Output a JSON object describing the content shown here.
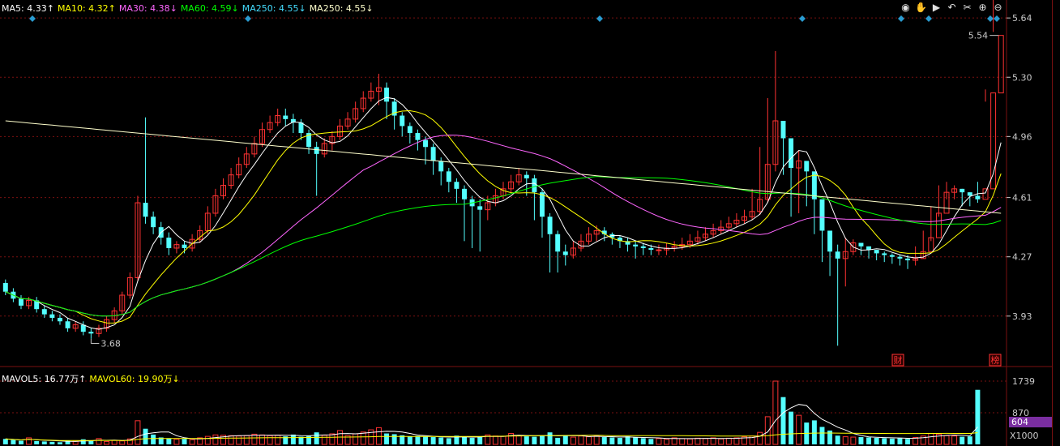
{
  "legend_price": [
    {
      "label": "MA5:",
      "value": "4.33",
      "arrow": "↑",
      "color": "#ffffff"
    },
    {
      "label": "MA10:",
      "value": "4.32",
      "arrow": "↑",
      "color": "#ffff00"
    },
    {
      "label": "MA30:",
      "value": "4.38",
      "arrow": "↓",
      "color": "#ff66ff"
    },
    {
      "label": "MA60:",
      "value": "4.59",
      "arrow": "↓",
      "color": "#00ff00"
    },
    {
      "label": "MA250:",
      "value": "4.55",
      "arrow": "↓",
      "color": "#44ddff"
    },
    {
      "label": "MA250:",
      "value": "4.55",
      "arrow": "↓",
      "color": "#ffffcc"
    }
  ],
  "legend_volume": [
    {
      "label": "MAVOL5:",
      "value": "16.77万",
      "arrow": "↑",
      "color": "#ffffff"
    },
    {
      "label": "MAVOL60:",
      "value": "19.90万",
      "arrow": "↓",
      "color": "#ffff00"
    }
  ],
  "toolbar": [
    {
      "name": "eye-icon",
      "glyph": "◉"
    },
    {
      "name": "hand-icon",
      "glyph": "✋"
    },
    {
      "name": "play-icon",
      "glyph": "▶"
    },
    {
      "name": "undo-icon",
      "glyph": "↶"
    },
    {
      "name": "scissors-icon",
      "glyph": "✂"
    },
    {
      "name": "zoom-in-icon",
      "glyph": "⊕"
    },
    {
      "name": "zoom-out-icon",
      "glyph": "⊖"
    }
  ],
  "volume_selected_label": "604",
  "volume_unit_label": "X1000",
  "colors": {
    "up": "#ff3232",
    "down": "#54ffff",
    "grid": "#7a1010",
    "axis": "#c8c8c8"
  },
  "chart_data": {
    "type": "candlestick",
    "y_ticks": [
      "5.64",
      "5.30",
      "4.96",
      "4.61",
      "4.27",
      "3.93"
    ],
    "ylim": [
      3.65,
      5.65
    ],
    "volume_ticks": [
      "1739",
      "870"
    ],
    "volume_ylim": [
      0,
      1739
    ],
    "annotations": {
      "high": "5.54",
      "low": "3.68"
    },
    "markers": [
      "财",
      "榜"
    ],
    "open": [
      4.12,
      4.07,
      4.03,
      3.99,
      4.02,
      3.97,
      3.94,
      3.92,
      3.9,
      3.86,
      3.88,
      3.84,
      3.83,
      3.86,
      3.91,
      3.96,
      4.05,
      4.15,
      4.58,
      4.5,
      4.44,
      4.38,
      4.32,
      4.34,
      4.32,
      4.37,
      4.42,
      4.52,
      4.62,
      4.68,
      4.74,
      4.8,
      4.86,
      4.92,
      5.0,
      5.04,
      5.08,
      5.06,
      5.04,
      4.98,
      4.9,
      4.86,
      4.92,
      4.96,
      5.02,
      5.06,
      5.12,
      5.18,
      5.22,
      5.24,
      5.16,
      5.08,
      5.02,
      4.98,
      4.94,
      4.9,
      4.82,
      4.76,
      4.7,
      4.66,
      4.6,
      4.56,
      4.54,
      4.58,
      4.62,
      4.66,
      4.7,
      4.74,
      4.72,
      4.64,
      4.5,
      4.4,
      4.3,
      4.28,
      4.32,
      4.36,
      4.4,
      4.42,
      4.4,
      4.38,
      4.36,
      4.34,
      4.33,
      4.32,
      4.31,
      4.31,
      4.32,
      4.33,
      4.34,
      4.36,
      4.38,
      4.4,
      4.42,
      4.44,
      4.46,
      4.48,
      4.5,
      4.53,
      4.6,
      4.8,
      5.05,
      4.95,
      4.78,
      4.82,
      4.76,
      4.6,
      4.42,
      4.3,
      4.26,
      4.3,
      4.35,
      4.33,
      4.31,
      4.29,
      4.28,
      4.27,
      4.26,
      4.25,
      4.26,
      4.3,
      4.38,
      4.52,
      4.64,
      4.66,
      4.64,
      4.62,
      4.6,
      4.66,
      5.21
    ],
    "close": [
      4.07,
      4.03,
      3.99,
      4.02,
      3.97,
      3.94,
      3.92,
      3.9,
      3.86,
      3.88,
      3.84,
      3.83,
      3.86,
      3.91,
      3.96,
      4.05,
      4.15,
      4.58,
      4.5,
      4.44,
      4.38,
      4.32,
      4.34,
      4.32,
      4.37,
      4.42,
      4.52,
      4.62,
      4.68,
      4.74,
      4.8,
      4.86,
      4.92,
      5.0,
      5.04,
      5.08,
      5.06,
      5.04,
      4.98,
      4.9,
      4.86,
      4.92,
      4.96,
      5.02,
      5.06,
      5.12,
      5.18,
      5.22,
      5.24,
      5.16,
      5.08,
      5.02,
      4.98,
      4.94,
      4.9,
      4.82,
      4.76,
      4.7,
      4.66,
      4.6,
      4.56,
      4.54,
      4.58,
      4.62,
      4.66,
      4.7,
      4.74,
      4.72,
      4.64,
      4.5,
      4.4,
      4.3,
      4.28,
      4.32,
      4.36,
      4.4,
      4.42,
      4.4,
      4.38,
      4.36,
      4.34,
      4.33,
      4.32,
      4.31,
      4.31,
      4.32,
      4.33,
      4.34,
      4.36,
      4.38,
      4.4,
      4.42,
      4.44,
      4.46,
      4.48,
      4.5,
      4.53,
      4.6,
      4.8,
      5.05,
      4.95,
      4.78,
      4.82,
      4.76,
      4.6,
      4.42,
      4.3,
      4.26,
      4.3,
      4.35,
      4.33,
      4.31,
      4.29,
      4.28,
      4.27,
      4.26,
      4.25,
      4.26,
      4.3,
      4.38,
      4.52,
      4.64,
      4.66,
      4.64,
      4.62,
      4.6,
      4.66,
      5.21,
      5.54
    ],
    "high": [
      4.14,
      4.09,
      4.05,
      4.04,
      4.04,
      3.99,
      3.96,
      3.94,
      3.92,
      3.9,
      3.9,
      3.86,
      3.88,
      3.93,
      3.98,
      4.07,
      4.18,
      4.62,
      5.07,
      4.53,
      4.47,
      4.41,
      4.36,
      4.36,
      4.4,
      4.45,
      4.56,
      4.66,
      4.72,
      4.78,
      4.84,
      4.9,
      4.96,
      5.04,
      5.08,
      5.12,
      5.12,
      5.09,
      5.06,
      5.0,
      4.93,
      4.95,
      4.99,
      5.06,
      5.1,
      5.16,
      5.22,
      5.27,
      5.32,
      5.27,
      5.18,
      5.1,
      5.04,
      5.0,
      4.96,
      4.92,
      4.84,
      4.78,
      4.72,
      4.68,
      4.62,
      4.6,
      4.62,
      4.66,
      4.7,
      4.74,
      4.78,
      4.76,
      4.74,
      4.66,
      4.52,
      4.42,
      4.34,
      4.36,
      4.4,
      4.44,
      4.45,
      4.44,
      4.41,
      4.39,
      4.38,
      4.36,
      4.35,
      4.34,
      4.34,
      4.35,
      4.36,
      4.38,
      4.4,
      4.42,
      4.44,
      4.46,
      4.48,
      4.5,
      4.52,
      4.54,
      4.66,
      4.9,
      5.18,
      5.45,
      5.0,
      4.9,
      4.88,
      4.8,
      4.62,
      4.46,
      4.34,
      4.34,
      4.38,
      4.37,
      4.35,
      4.33,
      4.31,
      4.3,
      4.29,
      4.28,
      4.28,
      4.33,
      4.42,
      4.56,
      4.68,
      4.7,
      4.68,
      4.66,
      4.64,
      4.7,
      5.23,
      5.56
    ],
    "low": [
      4.05,
      4.01,
      3.97,
      3.97,
      3.95,
      3.92,
      3.9,
      3.88,
      3.84,
      3.84,
      3.82,
      3.8,
      3.81,
      3.84,
      3.89,
      3.94,
      4.03,
      4.13,
      4.46,
      4.4,
      4.34,
      4.28,
      4.29,
      4.29,
      4.3,
      4.35,
      4.4,
      4.5,
      4.6,
      4.66,
      4.72,
      4.78,
      4.84,
      4.9,
      4.98,
      5.02,
      5.02,
      4.98,
      4.94,
      4.86,
      4.62,
      4.84,
      4.88,
      4.94,
      5.0,
      5.04,
      5.1,
      5.16,
      5.14,
      5.06,
      5.0,
      4.96,
      4.92,
      4.88,
      4.8,
      4.74,
      4.68,
      4.64,
      4.58,
      4.36,
      4.32,
      4.3,
      4.48,
      4.56,
      4.6,
      4.64,
      4.68,
      4.62,
      4.48,
      4.38,
      4.18,
      4.18,
      4.22,
      4.26,
      4.3,
      4.34,
      4.36,
      4.36,
      4.34,
      4.32,
      4.3,
      4.26,
      4.28,
      4.28,
      4.28,
      4.28,
      4.3,
      4.31,
      4.32,
      4.34,
      4.36,
      4.38,
      4.4,
      4.42,
      4.44,
      4.46,
      4.48,
      4.51,
      4.58,
      4.76,
      4.74,
      4.5,
      4.52,
      4.56,
      4.4,
      4.24,
      4.16,
      3.76,
      4.1,
      4.28,
      4.28,
      4.26,
      4.25,
      4.24,
      4.23,
      4.22,
      4.2,
      4.22,
      4.26,
      4.36,
      4.5,
      4.6,
      4.6,
      4.56,
      4.56,
      4.58,
      5.16
    ],
    "volume": [
      150,
      120,
      100,
      180,
      90,
      80,
      70,
      60,
      110,
      85,
      140,
      90,
      160,
      80,
      110,
      95,
      150,
      650,
      430,
      270,
      190,
      160,
      140,
      150,
      130,
      180,
      220,
      260,
      250,
      240,
      230,
      240,
      280,
      260,
      240,
      250,
      220,
      270,
      210,
      230,
      330,
      250,
      290,
      380,
      240,
      290,
      340,
      400,
      460,
      300,
      280,
      250,
      220,
      230,
      210,
      200,
      190,
      170,
      240,
      220,
      180,
      200,
      260,
      230,
      220,
      300,
      240,
      220,
      210,
      230,
      330,
      180,
      250,
      200,
      230,
      210,
      230,
      200,
      190,
      180,
      220,
      190,
      170,
      150,
      160,
      140,
      180,
      160,
      150,
      170,
      160,
      180,
      150,
      170,
      180,
      210,
      230,
      330,
      760,
      1739,
      1300,
      900,
      800,
      600,
      660,
      480,
      380,
      240,
      210,
      200,
      200,
      190,
      180,
      170,
      160,
      180,
      150,
      190,
      230,
      300,
      280,
      240,
      230,
      210,
      220,
      1500
    ]
  }
}
